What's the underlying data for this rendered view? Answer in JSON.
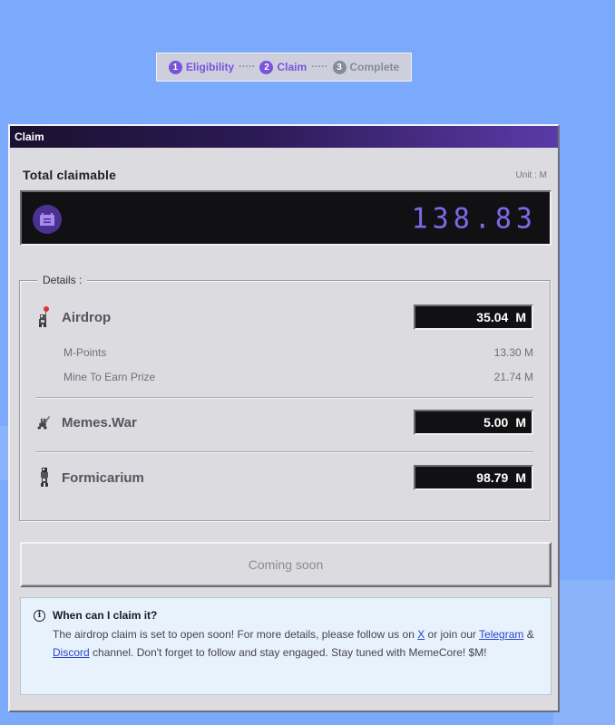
{
  "stepper": {
    "steps": [
      {
        "num": "1",
        "label": "Eligibility",
        "state": "active"
      },
      {
        "num": "2",
        "label": "Claim",
        "state": "active"
      },
      {
        "num": "3",
        "label": "Complete",
        "state": "inactive"
      }
    ],
    "separator": "·····"
  },
  "window": {
    "title": "Claim",
    "total_label": "Total claimable",
    "unit_label": "Unit : M",
    "total_value": "138.83",
    "wallet_icon": "wallet-icon"
  },
  "details": {
    "legend": "Details :",
    "airdrop": {
      "label": "Airdrop",
      "amount": "35.04",
      "unit": "M",
      "icon": "airdrop-character-icon",
      "sub_items": [
        {
          "label": "M-Points",
          "value": "13.30 M"
        },
        {
          "label": "Mine To Earn Prize",
          "value": "21.74 M"
        }
      ]
    },
    "memes_war": {
      "label": "Memes.War",
      "amount": "5.00",
      "unit": "M",
      "icon": "memes-war-character-icon"
    },
    "formicarium": {
      "label": "Formicarium",
      "amount": "98.79",
      "unit": "M",
      "icon": "formicarium-character-icon"
    }
  },
  "coming_soon_label": "Coming soon",
  "info": {
    "title": "When can I claim it?",
    "text_1": "The airdrop claim is set to open soon! For more details, please follow us on ",
    "link_x": "X",
    "text_2": " or join our ",
    "link_telegram": "Telegram",
    "text_3": " & ",
    "link_discord": "Discord",
    "text_4": " channel. Don't forget to follow and stay engaged. Stay tuned with MemeCore! $M!"
  },
  "colors": {
    "background": "#7ba9fb",
    "accent": "#7a52dc",
    "display_digits": "#8068e8"
  }
}
